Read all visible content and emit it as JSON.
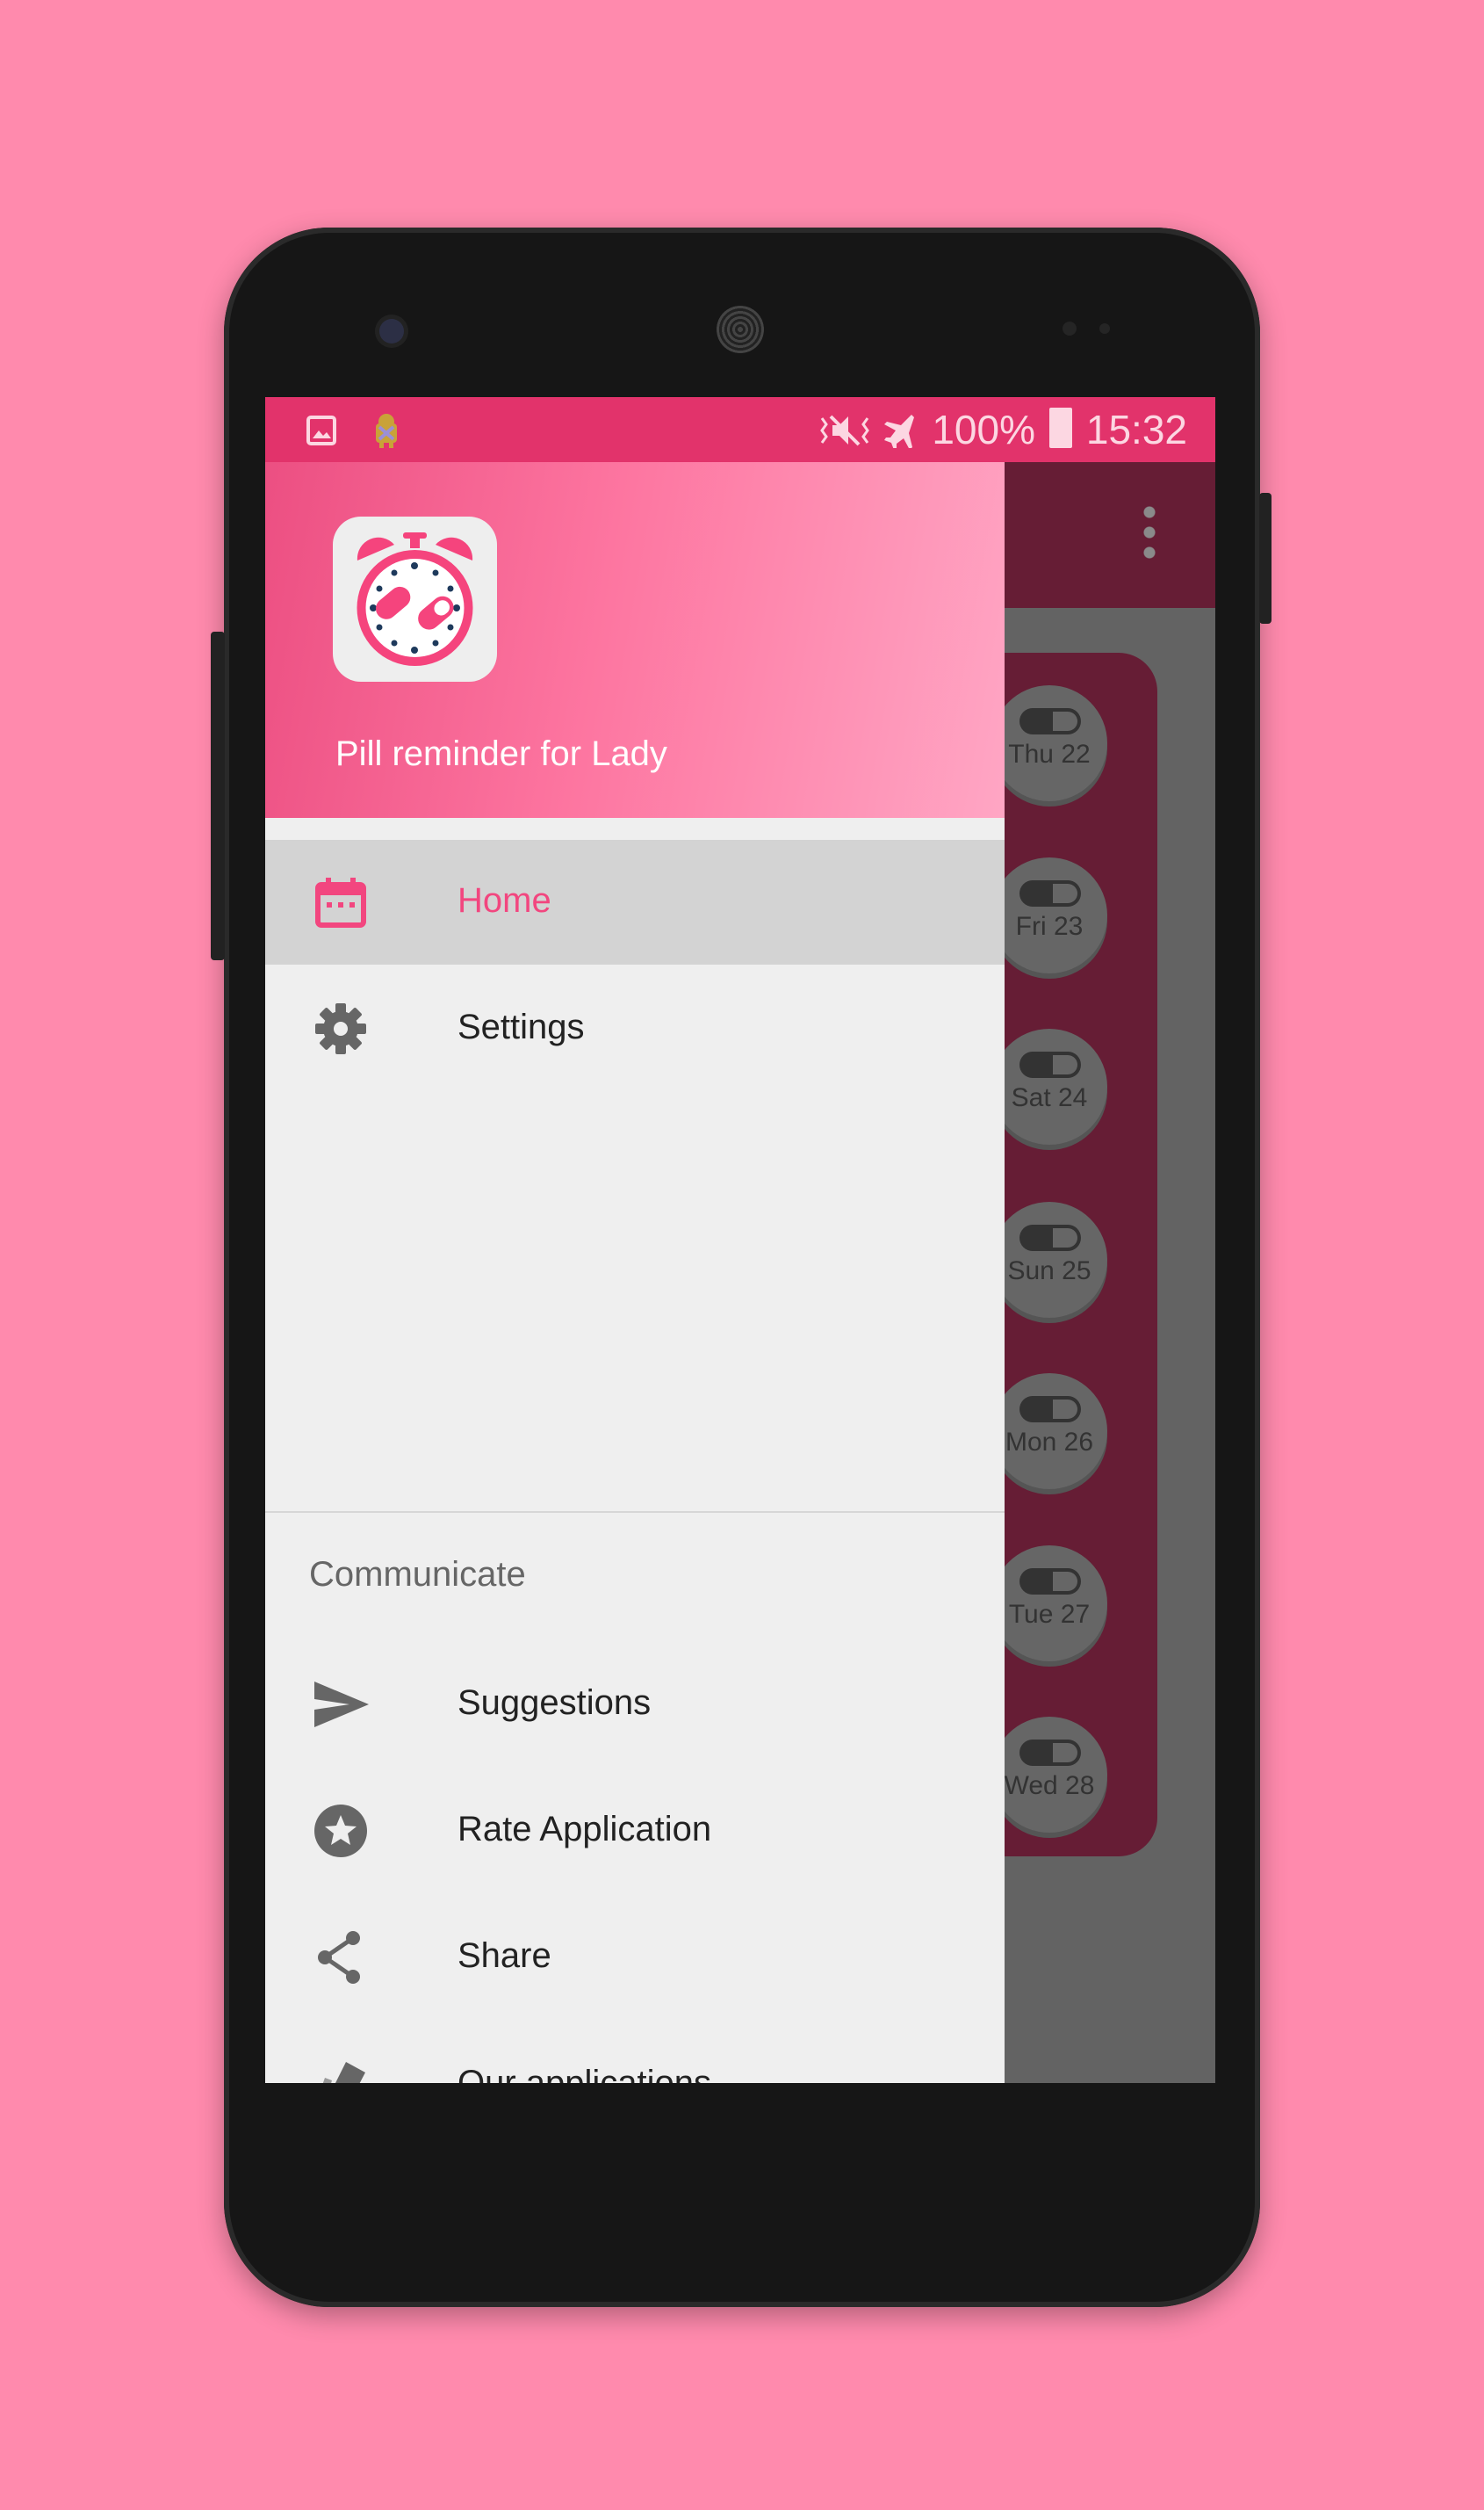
{
  "status_bar": {
    "battery": "100%",
    "time": "15:32",
    "icons": [
      "image-icon",
      "android-debug-icon",
      "vibrate-mute-icon",
      "airplane-icon",
      "battery-icon"
    ]
  },
  "drawer": {
    "app_title": "Pill reminder for Lady",
    "items": [
      {
        "label": "Home",
        "icon": "calendar-icon",
        "selected": true
      },
      {
        "label": "Settings",
        "icon": "gear-icon"
      }
    ],
    "section_title": "Communicate",
    "communicate_items": [
      {
        "label": "Suggestions",
        "icon": "send-icon"
      },
      {
        "label": "Rate Application",
        "icon": "star-icon"
      },
      {
        "label": "Share",
        "icon": "share-icon"
      },
      {
        "label": "Our applications",
        "icon": "apps-icon"
      }
    ]
  },
  "background_days": [
    "Thu 22",
    "Fri 23",
    "Sat 24",
    "Sun 25",
    "Mon 26",
    "Tue 27",
    "Wed 28"
  ],
  "colors": {
    "accent": "#f2467f",
    "status_bar": "#e2336b",
    "toolbar_dimmed": "#661d35",
    "page_background": "#ff8aad"
  }
}
